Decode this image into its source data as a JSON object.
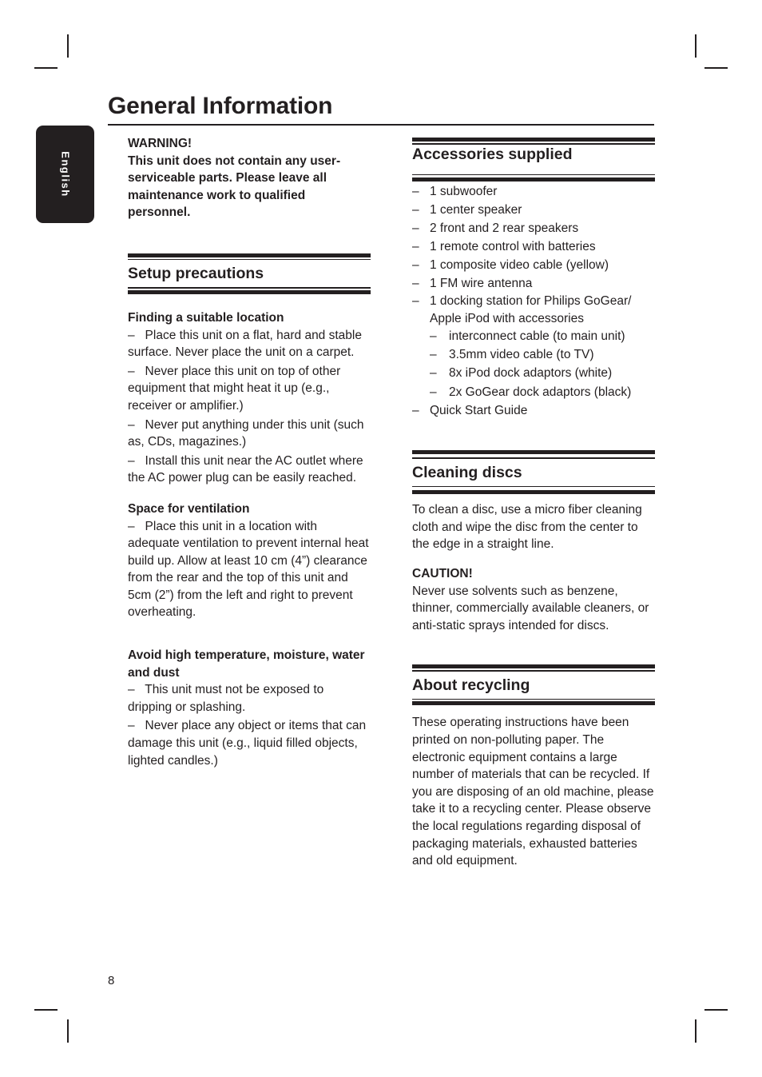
{
  "page": {
    "title": "General Information",
    "language_tab": "English",
    "page_number": "8"
  },
  "warning": {
    "label": "WARNING!",
    "text": "This unit does not contain any user-serviceable parts.  Please leave all maintenance work to qualified personnel."
  },
  "setup": {
    "heading": "Setup precautions",
    "location": {
      "heading": "Finding a suitable location",
      "items": [
        "Place this unit on a flat, hard and stable surface. Never place the unit on a carpet.",
        "Never place this unit on top of other equipment that might heat it up (e.g., receiver or amplifier.)",
        "Never put anything under this unit (such as, CDs, magazines.)",
        "Install this unit near the AC outlet where the AC power plug can be easily reached."
      ]
    },
    "ventilation": {
      "heading": "Space for ventilation",
      "items": [
        "Place this unit in a location with adequate ventilation to prevent internal heat build up.  Allow at least 10 cm (4”) clearance from the rear and the top of this unit and 5cm (2”) from the left and right to prevent overheating."
      ]
    },
    "environment": {
      "heading": "Avoid high temperature, moisture, water and dust",
      "items": [
        "This unit must not be exposed to dripping or splashing.",
        "Never place any object or items that can damage this unit (e.g., liquid filled objects, lighted candles.)"
      ]
    }
  },
  "accessories": {
    "heading": "Accessories supplied",
    "dash": "–",
    "items": [
      "1 subwoofer",
      "1 center speaker",
      "2 front and 2 rear speakers",
      "1 remote control with batteries",
      "1 composite video cable (yellow)",
      "1 FM wire antenna",
      "1 docking station for Philips GoGear/ Apple iPod with accessories",
      "Quick Start Guide"
    ],
    "dock_subitems": [
      "interconnect cable (to main unit)",
      "3.5mm video cable (to TV)",
      "8x iPod dock adaptors (white)",
      "2x GoGear dock adaptors (black)"
    ]
  },
  "cleaning": {
    "heading": "Cleaning discs",
    "text": "To clean a disc, use a micro fiber cleaning cloth and wipe the disc from the center to the edge in a straight line.",
    "caution_label": "CAUTION!",
    "caution_text": "Never use solvents such as benzene, thinner, commercially available cleaners, or anti-static sprays intended for discs."
  },
  "recycling": {
    "heading": "About recycling",
    "text": "These operating instructions have been printed on non-polluting paper. The electronic equipment contains a large number of materials that can be recycled. If you are disposing of an old machine, please take it to a recycling center. Please observe the local regulations regarding disposal of packaging materials, exhausted batteries and old equipment."
  }
}
